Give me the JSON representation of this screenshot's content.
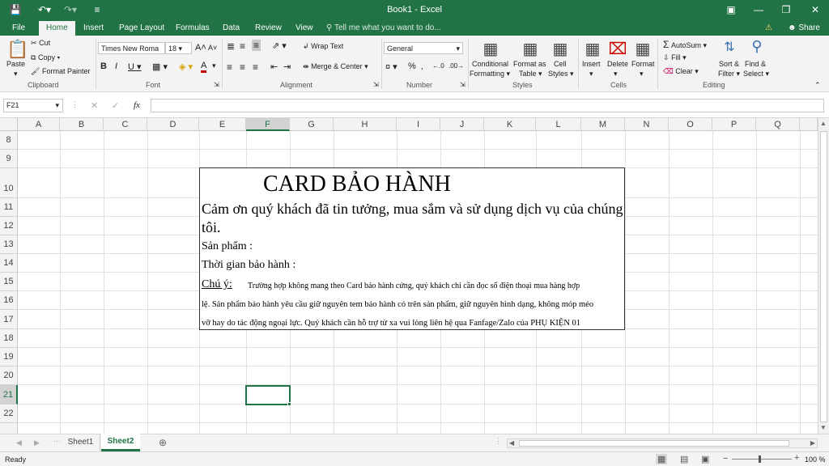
{
  "window": {
    "title": "Book1 - Excel"
  },
  "tabs": [
    "File",
    "Home",
    "Insert",
    "Page Layout",
    "Formulas",
    "Data",
    "Review",
    "View"
  ],
  "tell_me": "Tell me what you want to do...",
  "share": "Share",
  "clipboard": {
    "paste": "Paste",
    "cut": "Cut",
    "copy": "Copy",
    "format_painter": "Format Painter",
    "group": "Clipboard"
  },
  "font": {
    "name": "Times New Roma",
    "size": "18",
    "group": "Font"
  },
  "alignment": {
    "wrap": "Wrap Text",
    "merge": "Merge & Center",
    "group": "Alignment"
  },
  "number": {
    "format": "General",
    "group": "Number"
  },
  "styles": {
    "cond": "Conditional",
    "cond2": "Formatting",
    "fmt_table": "Format as",
    "fmt_table2": "Table",
    "cell": "Cell",
    "cell2": "Styles",
    "group": "Styles"
  },
  "cells": {
    "insert": "Insert",
    "delete": "Delete",
    "format": "Format",
    "group": "Cells"
  },
  "editing": {
    "autosum": "AutoSum",
    "fill": "Fill",
    "clear": "Clear",
    "sort": "Sort &",
    "sort2": "Filter",
    "find": "Find &",
    "find2": "Select",
    "group": "Editing"
  },
  "name_box": "F21",
  "fx": "fx",
  "columns": [
    "A",
    "B",
    "C",
    "D",
    "E",
    "F",
    "G",
    "H",
    "I",
    "J",
    "K",
    "L",
    "M",
    "N",
    "O",
    "P",
    "Q"
  ],
  "rows": [
    "8",
    "9",
    "10",
    "11",
    "12",
    "13",
    "14",
    "15",
    "16",
    "17",
    "18",
    "19",
    "20",
    "21",
    "22"
  ],
  "card": {
    "title": "CARD BẢO HÀNH",
    "thanks1": "Cảm ơn quý khách đã tin tưởng, mua sắm và sử dụng dịch vụ của chúng",
    "thanks2": "tôi.",
    "product": "Sản phẩm :",
    "warranty_time": "Thời gian bảo hành :",
    "note_label": "Chú ý:",
    "note1": "Trường hợp không mang theo Card bảo hành cứng, quý khách chỉ cần đọc số điện thoại mua hàng hợp",
    "note2": "lệ. Sản phẩm bảo hành yêu cầu giữ nguyên tem bảo hành có trên sản phẩm, giữ nguyên hình dạng, không móp méo",
    "note3": "vỡ hay do tác động ngoại lực. Quý khách cần hỗ trợ từ xa vui lòng liên hệ qua Fanfage/Zalo của PHỤ KIỆN 01"
  },
  "sheets": [
    "Sheet1",
    "Sheet2"
  ],
  "active_sheet": "Sheet2",
  "status": "Ready",
  "zoom": "100 %"
}
